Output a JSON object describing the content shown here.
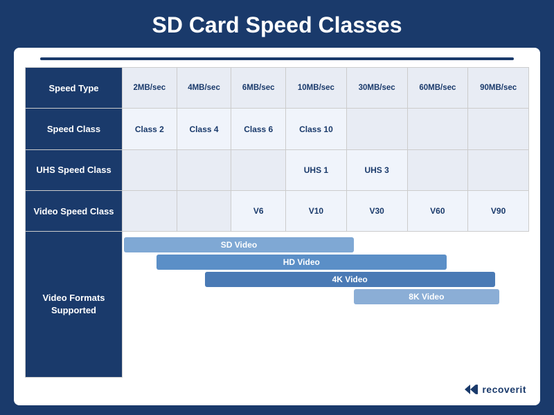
{
  "title": "SD Card Speed Classes",
  "topLine": true,
  "table": {
    "speedTypeRow": {
      "label": "Speed Type",
      "cells": [
        "2MB/sec",
        "4MB/sec",
        "6MB/sec",
        "10MB/sec",
        "30MB/sec",
        "60MB/sec",
        "90MB/sec"
      ]
    },
    "speedClassRow": {
      "label": "Speed Class",
      "cells": [
        "Class 2",
        "Class 4",
        "Class 6",
        "Class 10",
        "",
        "",
        ""
      ]
    },
    "uhsSpeedClassRow": {
      "label": "UHS Speed Class",
      "cells": [
        "",
        "",
        "",
        "UHS 1",
        "UHS 3",
        "",
        ""
      ]
    },
    "videoSpeedClassRow": {
      "label": "Video Speed Class",
      "cells": [
        "",
        "",
        "V6",
        "V10",
        "V30",
        "V60",
        "V90"
      ]
    },
    "videoFormatsRow": {
      "label": "Video Formats\nSupported",
      "bars": [
        {
          "label": "SD Video",
          "class": "bar-sd"
        },
        {
          "label": "HD Video",
          "class": "bar-hd"
        },
        {
          "label": "4K Video",
          "class": "bar-4k"
        },
        {
          "label": "8K Video",
          "class": "bar-8k"
        }
      ]
    }
  },
  "brand": {
    "name": "recoverit",
    "icon": "◀◀"
  }
}
